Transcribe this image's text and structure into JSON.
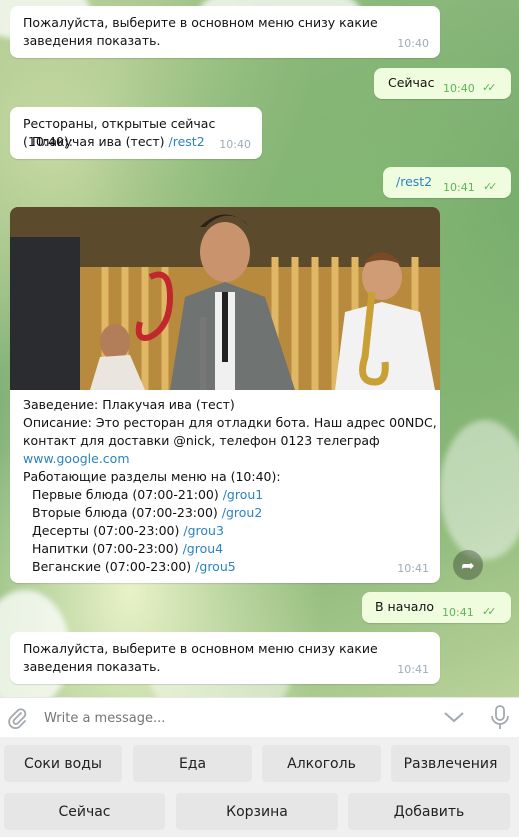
{
  "messages": {
    "m1": {
      "text": "Пожалуйста, выберите в основном меню снизу какие заведения показать.",
      "time": "10:40"
    },
    "m2": {
      "text": "Сейчас",
      "time": "10:40"
    },
    "m3": {
      "line1": "Рестораны, открытые сейчас (10:40):",
      "line2_text": "Плакучая ива (тест) ",
      "line2_link": "/rest2",
      "time": "10:40"
    },
    "m4": {
      "text": "/rest2",
      "time": "10:41"
    },
    "m5": {
      "line1": "Заведение: Плакучая ива (тест)",
      "line2": "Описание: Это ресторан для отладки бота. Наш адрес 00NDC,",
      "line3": "контакт для доставки @nick, телефон 0123 телеграф",
      "link": "www.google.com",
      "line5": "Работающие разделы меню на (10:40):",
      "sections": [
        {
          "text": "Первые блюда (07:00-21:00) ",
          "link": "/grou1"
        },
        {
          "text": "Вторые блюда (07:00-23:00) ",
          "link": "/grou2"
        },
        {
          "text": "Десерты (07:00-23:00) ",
          "link": "/grou3"
        },
        {
          "text": "Напитки (07:00-23:00) ",
          "link": "/grou4"
        },
        {
          "text": "Веганские (07:00-23:00) ",
          "link": "/grou5"
        }
      ],
      "time": "10:41"
    },
    "m6": {
      "text": "В начало",
      "time": "10:41"
    },
    "m7": {
      "text": "Пожалуйста, выберите в основном меню снизу какие заведения показать.",
      "time": "10:41"
    }
  },
  "input": {
    "placeholder": "Write a message..."
  },
  "keyboard": {
    "row1": [
      "Соки воды",
      "Еда",
      "Алкоголь",
      "Развлечения"
    ],
    "row2": [
      "Сейчас",
      "Корзина",
      "Добавить"
    ]
  },
  "icons": {
    "attach": "paperclip-icon",
    "emoji_toggle": "chevron-down-icon",
    "mic": "microphone-icon",
    "share": "share-icon",
    "read": "double-check-icon"
  },
  "colors": {
    "outgoing_bubble": "#effdde",
    "incoming_bubble": "#ffffff",
    "link": "#2a83c4",
    "check": "#5fb35a"
  }
}
